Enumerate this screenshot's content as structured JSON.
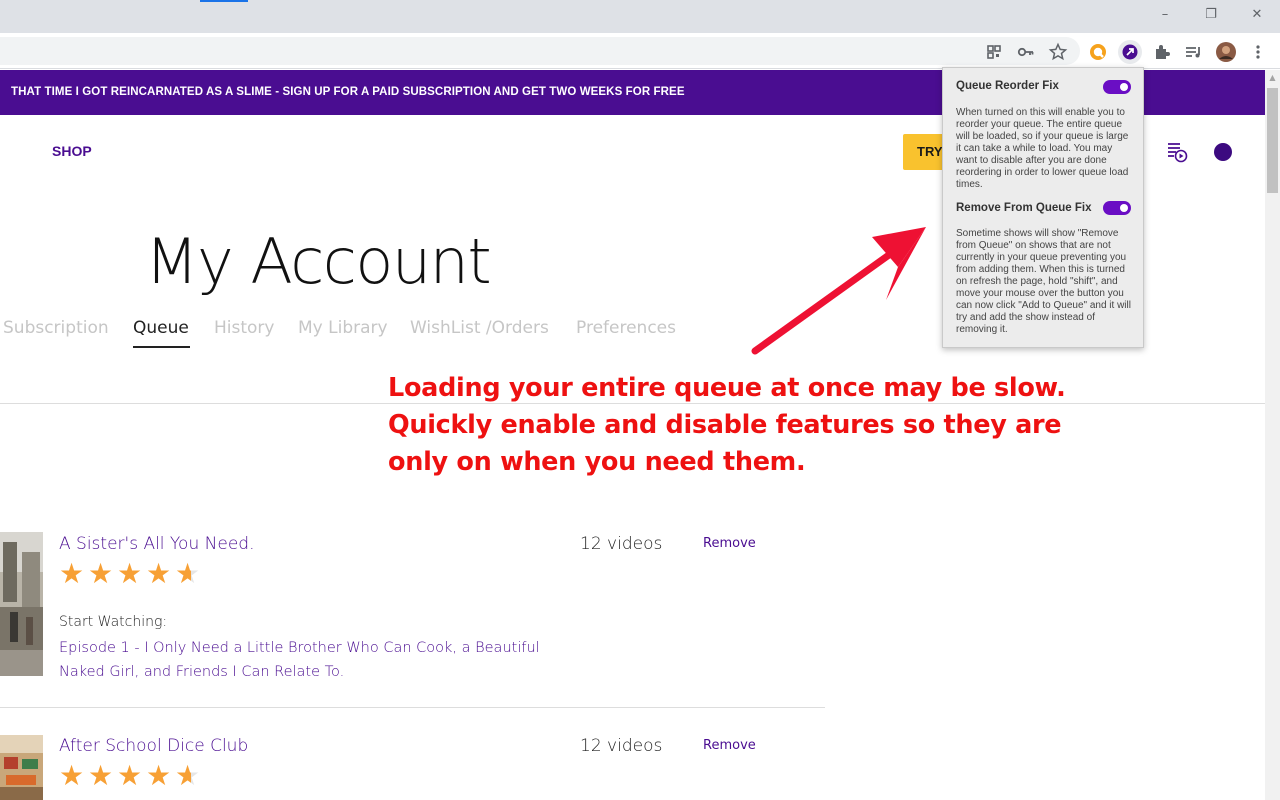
{
  "browser": {
    "window_controls": {
      "minimize": "–",
      "restore": "❐",
      "close": "✕"
    },
    "toolbar_icons": [
      "qr-code-icon",
      "key-icon",
      "star-icon",
      "quick-ext-icon",
      "queue-ext-icon",
      "extensions-icon",
      "media-queue-icon",
      "profile-avatar",
      "menu-icon"
    ]
  },
  "banner": {
    "text": "THAT TIME I GOT REINCARNATED AS A SLIME - SIGN UP FOR A PAID SUBSCRIPTION AND GET TWO WEEKS FOR FREE"
  },
  "header": {
    "shop": "SHOP",
    "try_button": "TRY"
  },
  "page": {
    "title": "My Account",
    "tabs": [
      {
        "label": "Subscription",
        "active": false
      },
      {
        "label": "Queue",
        "active": true
      },
      {
        "label": "History",
        "active": false
      },
      {
        "label": "My Library",
        "active": false
      },
      {
        "label": "WishList /Orders",
        "active": false
      },
      {
        "label": "Preferences",
        "active": false
      }
    ]
  },
  "queue": [
    {
      "title": "A Sister's All You Need.",
      "rating": 4.5,
      "videos": "12 videos",
      "remove": "Remove",
      "start_watching_label": "Start Watching:",
      "episode": "Episode 1 - I Only Need a Little Brother Who Can Cook, a Beautiful Naked Girl, and Friends I Can Relate To."
    },
    {
      "title": "After School Dice Club",
      "rating": 4.5,
      "videos": "12 videos",
      "remove": "Remove"
    }
  ],
  "popup": {
    "reorder": {
      "label": "Queue Reorder Fix",
      "enabled": true,
      "description": "When turned on this will enable you to reorder your queue. The entire queue will be loaded, so if your queue is large it can take a while to load. You may want to disable after you are done reordering in order to lower queue load times."
    },
    "remove_fix": {
      "label": "Remove From Queue Fix",
      "enabled": true,
      "description": "Sometime shows will show \"Remove from Queue\" on shows that are not currently in your queue preventing you from adding them. When this is turned on refresh the page, hold \"shift\", and move your mouse over the button you can now click \"Add to Queue\" and it will try and add the show instead of removing it."
    }
  },
  "annotation": {
    "line1": "Loading your entire queue at once may be slow.",
    "line2": "Quickly enable and disable features so they are",
    "line3": "only on when you need them."
  },
  "colors": {
    "brand": "#4a0d91",
    "accent": "#f9c22e",
    "star": "#f7a035",
    "annotation": "#ee1111",
    "toggle": "#6a0ec4"
  }
}
